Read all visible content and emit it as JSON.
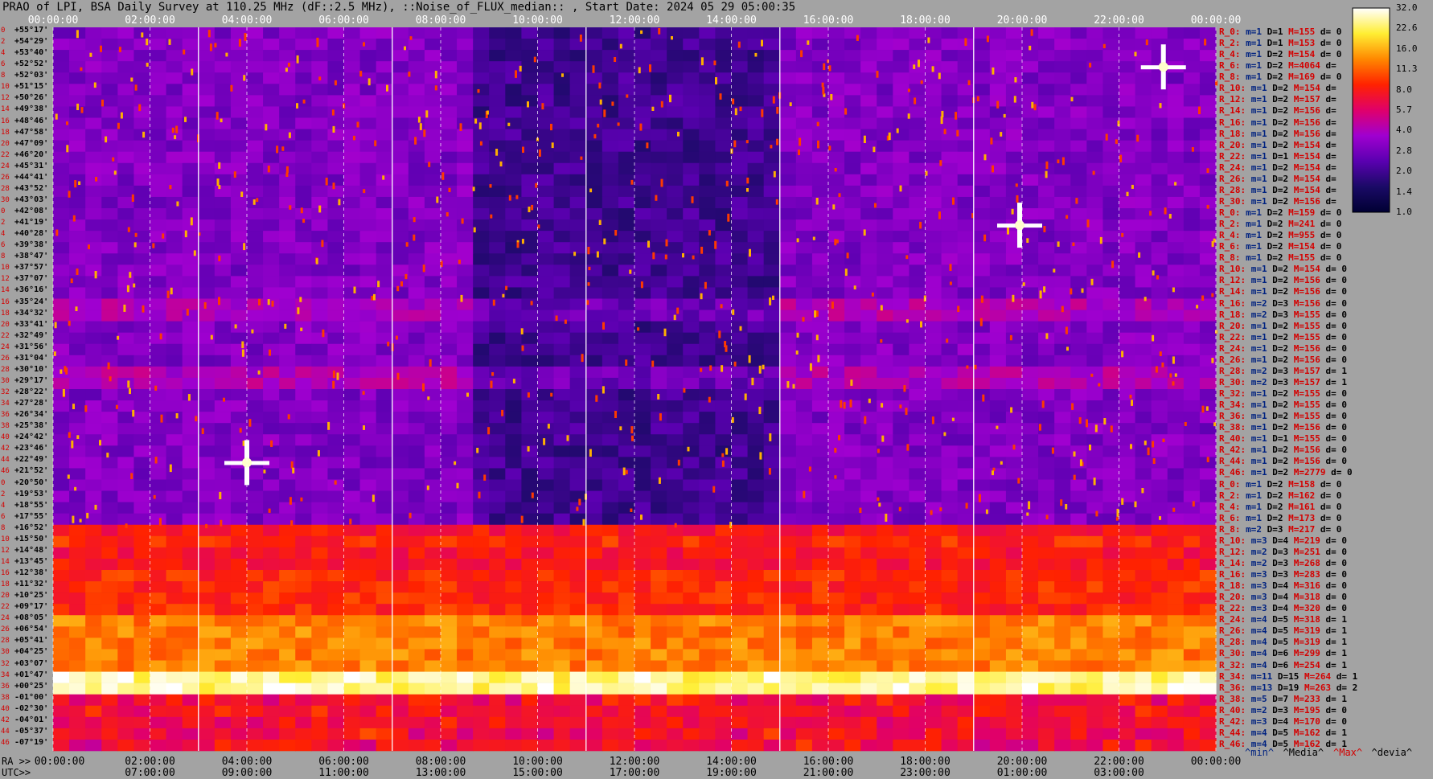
{
  "title": "PRAO of LPI, BSA Daily Survey at 110.25 MHz (dF::2.5 MHz), ::Noise_of_FLUX_median:: , Start Date: 2024 05 29 05:00:35",
  "ra_axis_label": "RA >>",
  "utc_axis_label": "UTC>>",
  "chart_data": {
    "type": "heatmap",
    "title": "PRAO of LPI, BSA Daily Survey at 110.25 MHz (dF::2.5 MHz), ::Noise_of_FLUX_median:: , Start Date: 2024 05 29 05:00:35",
    "top_ticks": [
      "00:00:00",
      "02:00:00",
      "04:00:00",
      "06:00:00",
      "08:00:00",
      "10:00:00",
      "12:00:00",
      "14:00:00",
      "16:00:00",
      "18:00:00",
      "20:00:00",
      "22:00:00",
      "00:00:00"
    ],
    "ra_ticks": [
      "00:00:00",
      "02:00:00",
      "04:00:00",
      "06:00:00",
      "08:00:00",
      "10:00:00",
      "12:00:00",
      "14:00:00",
      "16:00:00",
      "18:00:00",
      "20:00:00",
      "22:00:00",
      "00:00:00"
    ],
    "utc_ticks": [
      "07:00:00",
      "09:00:00",
      "11:00:00",
      "13:00:00",
      "15:00:00",
      "17:00:00",
      "19:00:00",
      "21:00:00",
      "23:00:00",
      "01:00:00",
      "03:00:00"
    ],
    "colorbar_ticks": [
      "32.0",
      "22.6",
      "16.0",
      "11.3",
      "8.0",
      "5.7",
      "4.0",
      "2.8",
      "2.0",
      "1.4",
      "1.0"
    ],
    "colorbar_range": [
      1.0,
      32.0
    ],
    "colorbar_scale": "log",
    "colormap": [
      "#000033",
      "#1a0a66",
      "#5a00b0",
      "#a000d0",
      "#e0006a",
      "#ff2200",
      "#ff8800",
      "#ffee33",
      "#ffffff"
    ],
    "declinations": [
      "+55°17'",
      "+54°29'",
      "+53°40'",
      "+52°52'",
      "+52°03'",
      "+51°15'",
      "+50°26'",
      "+49°38'",
      "+48°46'",
      "+47°58'",
      "+47°09'",
      "+46°20'",
      "+45°31'",
      "+44°41'",
      "+43°52'",
      "+43°03'",
      "+42°08'",
      "+41°19'",
      "+40°28'",
      "+39°38'",
      "+38°47'",
      "+37°57'",
      "+37°07'",
      "+36°16'",
      "+35°24'",
      "+34°32'",
      "+33°41'",
      "+32°49'",
      "+31°56'",
      "+31°04'",
      "+30°10'",
      "+29°17'",
      "+28°22'",
      "+27°28'",
      "+26°34'",
      "+25°38'",
      "+24°42'",
      "+23°46'",
      "+22°49'",
      "+21°52'",
      "+20°50'",
      "+19°53'",
      "+18°55'",
      "+17°55'",
      "+16°52'",
      "+15°50'",
      "+14°48'",
      "+13°45'",
      "+12°38'",
      "+11°32'",
      "+10°25'",
      "+09°17'",
      "+08°05'",
      "+06°54'",
      "+05°41'",
      "+04°25'",
      "+03°07'",
      "+01°47'",
      "+00°25'",
      "-01°00'",
      "-02°30'",
      "-04°01'",
      "-05°37'",
      "-07°19'"
    ],
    "row_index": [
      "0",
      "2",
      "4",
      "6",
      "8",
      "10",
      "12",
      "14",
      "16",
      "18",
      "20",
      "22",
      "24",
      "26",
      "28",
      "30",
      "0",
      "2",
      "4",
      "6",
      "8",
      "10",
      "12",
      "14",
      "16",
      "18",
      "20",
      "22",
      "24",
      "26",
      "28",
      "30",
      "32",
      "34",
      "36",
      "38",
      "40",
      "42",
      "44",
      "46",
      "0",
      "2",
      "4",
      "6",
      "8",
      "10",
      "12",
      "14",
      "16",
      "18",
      "20",
      "22",
      "24",
      "26",
      "28",
      "30",
      "32",
      "34",
      "36",
      "38",
      "40",
      "42",
      "44",
      "46"
    ],
    "stats": [
      {
        "r": "R_0:",
        "m": "m=1",
        "D": "D=1",
        "M": "M=155",
        "d": "d= 0"
      },
      {
        "r": "R_2:",
        "m": "m=1",
        "D": "D=1",
        "M": "M=153",
        "d": "d= 0"
      },
      {
        "r": "R_4:",
        "m": "m=1",
        "D": "D=2",
        "M": "M=154",
        "d": "d= 0"
      },
      {
        "r": "R_6:",
        "m": "m=1",
        "D": "D=2",
        "M": "M=4064",
        "d": "d="
      },
      {
        "r": "R_8:",
        "m": "m=1",
        "D": "D=2",
        "M": "M=169",
        "d": "d= 0"
      },
      {
        "r": "R_10:",
        "m": "m=1",
        "D": "D=2",
        "M": "M=154",
        "d": "d="
      },
      {
        "r": "R_12:",
        "m": "m=1",
        "D": "D=2",
        "M": "M=157",
        "d": "d="
      },
      {
        "r": "R_14:",
        "m": "m=1",
        "D": "D=2",
        "M": "M=156",
        "d": "d="
      },
      {
        "r": "R_16:",
        "m": "m=1",
        "D": "D=2",
        "M": "M=156",
        "d": "d="
      },
      {
        "r": "R_18:",
        "m": "m=1",
        "D": "D=2",
        "M": "M=156",
        "d": "d="
      },
      {
        "r": "R_20:",
        "m": "m=1",
        "D": "D=2",
        "M": "M=154",
        "d": "d="
      },
      {
        "r": "R_22:",
        "m": "m=1",
        "D": "D=1",
        "M": "M=154",
        "d": "d="
      },
      {
        "r": "R_24:",
        "m": "m=1",
        "D": "D=2",
        "M": "M=154",
        "d": "d="
      },
      {
        "r": "R_26:",
        "m": "m=1",
        "D": "D=2",
        "M": "M=154",
        "d": "d="
      },
      {
        "r": "R_28:",
        "m": "m=1",
        "D": "D=2",
        "M": "M=154",
        "d": "d="
      },
      {
        "r": "R_30:",
        "m": "m=1",
        "D": "D=2",
        "M": "M=156",
        "d": "d="
      },
      {
        "r": "R_0:",
        "m": "m=1",
        "D": "D=2",
        "M": "M=159",
        "d": "d= 0"
      },
      {
        "r": "R_2:",
        "m": "m=1",
        "D": "D=2",
        "M": "M=241",
        "d": "d= 0"
      },
      {
        "r": "R_4:",
        "m": "m=1",
        "D": "D=2",
        "M": "M=955",
        "d": "d= 0"
      },
      {
        "r": "R_6:",
        "m": "m=1",
        "D": "D=2",
        "M": "M=154",
        "d": "d= 0"
      },
      {
        "r": "R_8:",
        "m": "m=1",
        "D": "D=2",
        "M": "M=155",
        "d": "d= 0"
      },
      {
        "r": "R_10:",
        "m": "m=1",
        "D": "D=2",
        "M": "M=154",
        "d": "d= 0"
      },
      {
        "r": "R_12:",
        "m": "m=1",
        "D": "D=2",
        "M": "M=156",
        "d": "d= 0"
      },
      {
        "r": "R_14:",
        "m": "m=1",
        "D": "D=2",
        "M": "M=156",
        "d": "d= 0"
      },
      {
        "r": "R_16:",
        "m": "m=2",
        "D": "D=3",
        "M": "M=156",
        "d": "d= 0"
      },
      {
        "r": "R_18:",
        "m": "m=2",
        "D": "D=3",
        "M": "M=155",
        "d": "d= 0"
      },
      {
        "r": "R_20:",
        "m": "m=1",
        "D": "D=2",
        "M": "M=155",
        "d": "d= 0"
      },
      {
        "r": "R_22:",
        "m": "m=1",
        "D": "D=2",
        "M": "M=155",
        "d": "d= 0"
      },
      {
        "r": "R_24:",
        "m": "m=1",
        "D": "D=2",
        "M": "M=156",
        "d": "d= 0"
      },
      {
        "r": "R_26:",
        "m": "m=1",
        "D": "D=2",
        "M": "M=156",
        "d": "d= 0"
      },
      {
        "r": "R_28:",
        "m": "m=2",
        "D": "D=3",
        "M": "M=157",
        "d": "d= 1"
      },
      {
        "r": "R_30:",
        "m": "m=2",
        "D": "D=3",
        "M": "M=157",
        "d": "d= 1"
      },
      {
        "r": "R_32:",
        "m": "m=1",
        "D": "D=2",
        "M": "M=155",
        "d": "d= 0"
      },
      {
        "r": "R_34:",
        "m": "m=1",
        "D": "D=2",
        "M": "M=155",
        "d": "d= 0"
      },
      {
        "r": "R_36:",
        "m": "m=1",
        "D": "D=2",
        "M": "M=155",
        "d": "d= 0"
      },
      {
        "r": "R_38:",
        "m": "m=1",
        "D": "D=2",
        "M": "M=156",
        "d": "d= 0"
      },
      {
        "r": "R_40:",
        "m": "m=1",
        "D": "D=1",
        "M": "M=155",
        "d": "d= 0"
      },
      {
        "r": "R_42:",
        "m": "m=1",
        "D": "D=2",
        "M": "M=156",
        "d": "d= 0"
      },
      {
        "r": "R_44:",
        "m": "m=1",
        "D": "D=2",
        "M": "M=156",
        "d": "d= 0"
      },
      {
        "r": "R_46:",
        "m": "m=1",
        "D": "D=2",
        "M": "M=2779",
        "d": "d= 0"
      },
      {
        "r": "R_0:",
        "m": "m=1",
        "D": "D=2",
        "M": "M=158",
        "d": "d= 0"
      },
      {
        "r": "R_2:",
        "m": "m=1",
        "D": "D=2",
        "M": "M=162",
        "d": "d= 0"
      },
      {
        "r": "R_4:",
        "m": "m=1",
        "D": "D=2",
        "M": "M=161",
        "d": "d= 0"
      },
      {
        "r": "R_6:",
        "m": "m=1",
        "D": "D=2",
        "M": "M=173",
        "d": "d= 0"
      },
      {
        "r": "R_8:",
        "m": "m=2",
        "D": "D=3",
        "M": "M=217",
        "d": "d= 0"
      },
      {
        "r": "R_10:",
        "m": "m=3",
        "D": "D=4",
        "M": "M=219",
        "d": "d= 0"
      },
      {
        "r": "R_12:",
        "m": "m=2",
        "D": "D=3",
        "M": "M=251",
        "d": "d= 0"
      },
      {
        "r": "R_14:",
        "m": "m=2",
        "D": "D=3",
        "M": "M=268",
        "d": "d= 0"
      },
      {
        "r": "R_16:",
        "m": "m=3",
        "D": "D=3",
        "M": "M=283",
        "d": "d= 0"
      },
      {
        "r": "R_18:",
        "m": "m=3",
        "D": "D=4",
        "M": "M=316",
        "d": "d= 0"
      },
      {
        "r": "R_20:",
        "m": "m=3",
        "D": "D=4",
        "M": "M=318",
        "d": "d= 0"
      },
      {
        "r": "R_22:",
        "m": "m=3",
        "D": "D=4",
        "M": "M=320",
        "d": "d= 0"
      },
      {
        "r": "R_24:",
        "m": "m=4",
        "D": "D=5",
        "M": "M=318",
        "d": "d= 1"
      },
      {
        "r": "R_26:",
        "m": "m=4",
        "D": "D=5",
        "M": "M=319",
        "d": "d= 1"
      },
      {
        "r": "R_28:",
        "m": "m=4",
        "D": "D=5",
        "M": "M=319",
        "d": "d= 1"
      },
      {
        "r": "R_30:",
        "m": "m=4",
        "D": "D=6",
        "M": "M=299",
        "d": "d= 1"
      },
      {
        "r": "R_32:",
        "m": "m=4",
        "D": "D=6",
        "M": "M=254",
        "d": "d= 1"
      },
      {
        "r": "R_34:",
        "m": "m=11",
        "D": "D=15",
        "M": "M=264",
        "d": "d= 1"
      },
      {
        "r": "R_36:",
        "m": "m=13",
        "D": "D=19",
        "M": "M=263",
        "d": "d= 2"
      },
      {
        "r": "R_38:",
        "m": "m=5",
        "D": "D=7",
        "M": "M=233",
        "d": "d= 1"
      },
      {
        "r": "R_40:",
        "m": "m=2",
        "D": "D=3",
        "M": "M=195",
        "d": "d= 0"
      },
      {
        "r": "R_42:",
        "m": "m=3",
        "D": "D=4",
        "M": "M=170",
        "d": "d= 0"
      },
      {
        "r": "R_44:",
        "m": "m=4",
        "D": "D=5",
        "M": "M=162",
        "d": "d= 1"
      },
      {
        "r": "R_46:",
        "m": "m=4",
        "D": "D=5",
        "M": "M=162",
        "d": "d= 1"
      }
    ],
    "legend": [
      {
        "label": "^min^",
        "color": "#002280"
      },
      {
        "label": "^Media^",
        "color": "#000000"
      },
      {
        "label": "^Max^",
        "color": "#d40000"
      },
      {
        "label": "^devia^",
        "color": "#000000"
      }
    ],
    "bright_sources": [
      {
        "ra": "04:00:00",
        "dec": "+22°49'"
      },
      {
        "ra": "19:57:00",
        "dec": "+41°19'"
      },
      {
        "ra": "22:55:00",
        "dec": "+52°52'"
      }
    ]
  }
}
